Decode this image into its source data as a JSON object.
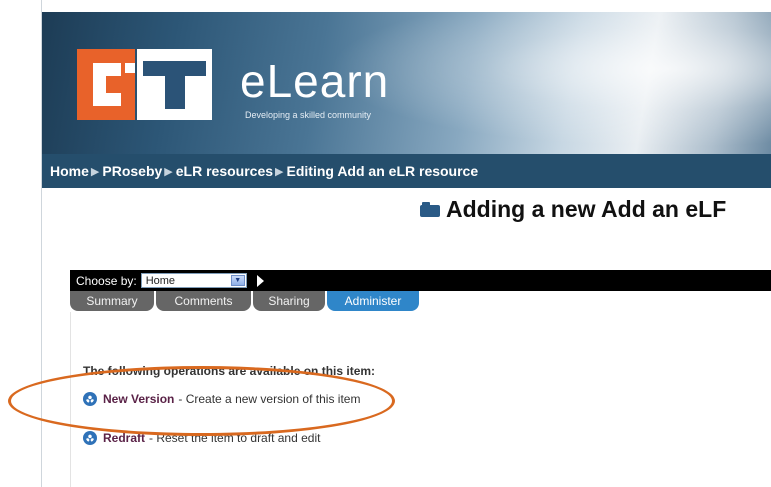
{
  "header": {
    "logo_text": "CIT",
    "brand": "eLearn",
    "tagline": "Developing a skilled community"
  },
  "breadcrumb": [
    "Home",
    "PRoseby",
    "eLR resources",
    "Editing Add an eLR resource"
  ],
  "page_title": "Adding a new Add an eLF",
  "choose_by": {
    "label": "Choose by:",
    "selected": "Home"
  },
  "tabs": [
    {
      "label": "Summary",
      "active": false
    },
    {
      "label": "Comments",
      "active": false
    },
    {
      "label": "Sharing",
      "active": false
    },
    {
      "label": "Administer",
      "active": true
    }
  ],
  "operations": {
    "heading": "The following operations are available on this item:",
    "items": [
      {
        "link": "New Version",
        "description": "- Create a new version of this item"
      },
      {
        "link": "Redraft",
        "description": "- Reset the item to draft and edit"
      }
    ]
  },
  "colors": {
    "breadcrumb_bg": "#254e6c",
    "active_tab": "#2f86c9",
    "inactive_tab": "#666666",
    "annotation": "#d9691f",
    "link": "#5a2247"
  }
}
